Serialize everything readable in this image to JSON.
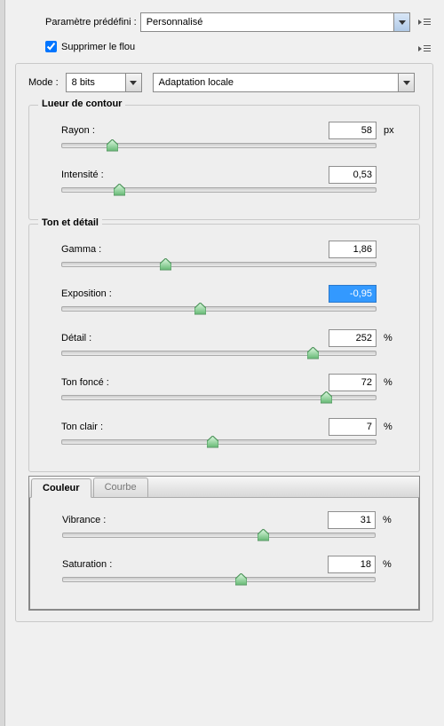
{
  "preset": {
    "label": "Paramètre prédéfini :",
    "value": "Personnalisé"
  },
  "removeBlur": {
    "label": "Supprimer le flou",
    "checked": true
  },
  "mode": {
    "label": "Mode :",
    "bits": "8 bits",
    "method": "Adaptation locale"
  },
  "edgeGlow": {
    "title": "Lueur de contour",
    "radius": {
      "label": "Rayon :",
      "value": "58",
      "unit": "px",
      "pos": 16
    },
    "strength": {
      "label": "Intensité :",
      "value": "0,53",
      "unit": "",
      "pos": 18
    }
  },
  "toneDetail": {
    "title": "Ton et détail",
    "gamma": {
      "label": "Gamma :",
      "value": "1,86",
      "unit": "",
      "pos": 33
    },
    "exposure": {
      "label": "Exposition :",
      "value": "-0,95",
      "unit": "",
      "pos": 44,
      "selected": true
    },
    "detail": {
      "label": "Détail :",
      "value": "252",
      "unit": "%",
      "pos": 80
    },
    "shadow": {
      "label": "Ton foncé :",
      "value": "72",
      "unit": "%",
      "pos": 84
    },
    "highlight": {
      "label": "Ton clair :",
      "value": "7",
      "unit": "%",
      "pos": 48
    }
  },
  "colorTabs": {
    "colorLabel": "Couleur",
    "curveLabel": "Courbe",
    "vibrance": {
      "label": "Vibrance :",
      "value": "31",
      "unit": "%",
      "pos": 64
    },
    "saturation": {
      "label": "Saturation :",
      "value": "18",
      "unit": "%",
      "pos": 57
    }
  }
}
